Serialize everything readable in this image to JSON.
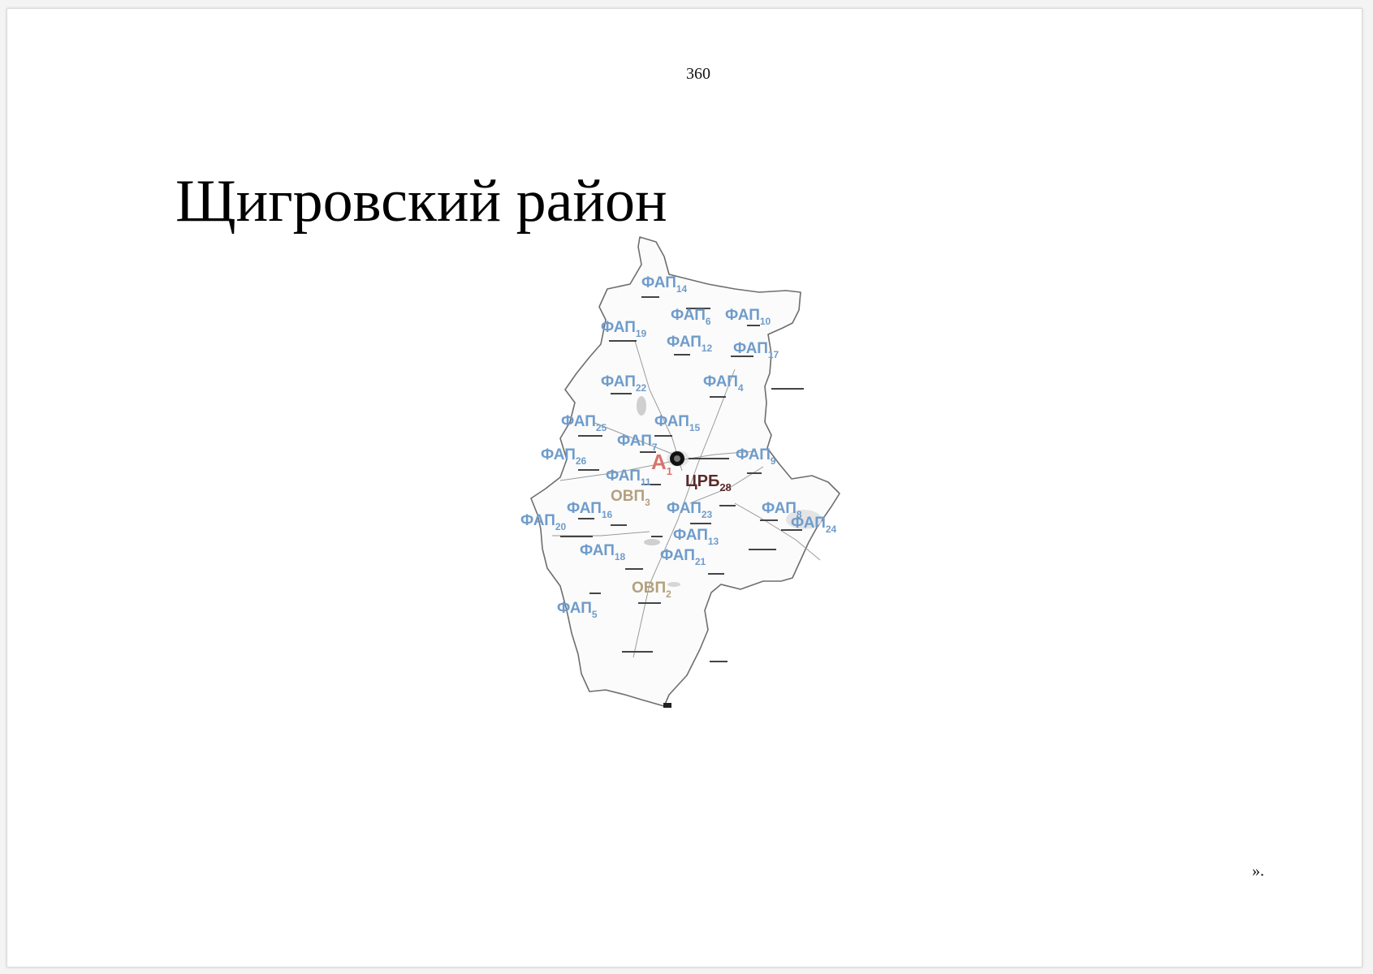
{
  "page": {
    "number": "360",
    "title": "Щигровский район",
    "closing_mark": "»."
  },
  "colors": {
    "fap": "#6f9ccb",
    "ovp": "#b4a07e",
    "crb": "#5a2a2a",
    "pharmacy": "#d9736e",
    "border": "#6e6e6e"
  },
  "map": {
    "markers": [
      {
        "type": "ФАП",
        "num": "14"
      },
      {
        "type": "ФАП",
        "num": "6"
      },
      {
        "type": "ФАП",
        "num": "10"
      },
      {
        "type": "ФАП",
        "num": "19"
      },
      {
        "type": "ФАП",
        "num": "12"
      },
      {
        "type": "ФАП",
        "num": "17"
      },
      {
        "type": "ФАП",
        "num": "22"
      },
      {
        "type": "ФАП",
        "num": "4"
      },
      {
        "type": "ФАП",
        "num": "25"
      },
      {
        "type": "ФАП",
        "num": "15"
      },
      {
        "type": "ФАП",
        "num": "7"
      },
      {
        "type": "ФАП",
        "num": "26"
      },
      {
        "type": "ФАП",
        "num": "9"
      },
      {
        "type": "А",
        "num": "1"
      },
      {
        "type": "ФАП",
        "num": "11"
      },
      {
        "type": "ЦРБ",
        "num": "28"
      },
      {
        "type": "ОВП",
        "num": "3"
      },
      {
        "type": "ФАП",
        "num": "16"
      },
      {
        "type": "ФАП",
        "num": "23"
      },
      {
        "type": "ФАП",
        "num": "8"
      },
      {
        "type": "ФАП",
        "num": "20"
      },
      {
        "type": "ФАП",
        "num": "24"
      },
      {
        "type": "ФАП",
        "num": "13"
      },
      {
        "type": "ФАП",
        "num": "18"
      },
      {
        "type": "ФАП",
        "num": "21"
      },
      {
        "type": "ОВП",
        "num": "2"
      },
      {
        "type": "ФАП",
        "num": "5"
      }
    ]
  }
}
